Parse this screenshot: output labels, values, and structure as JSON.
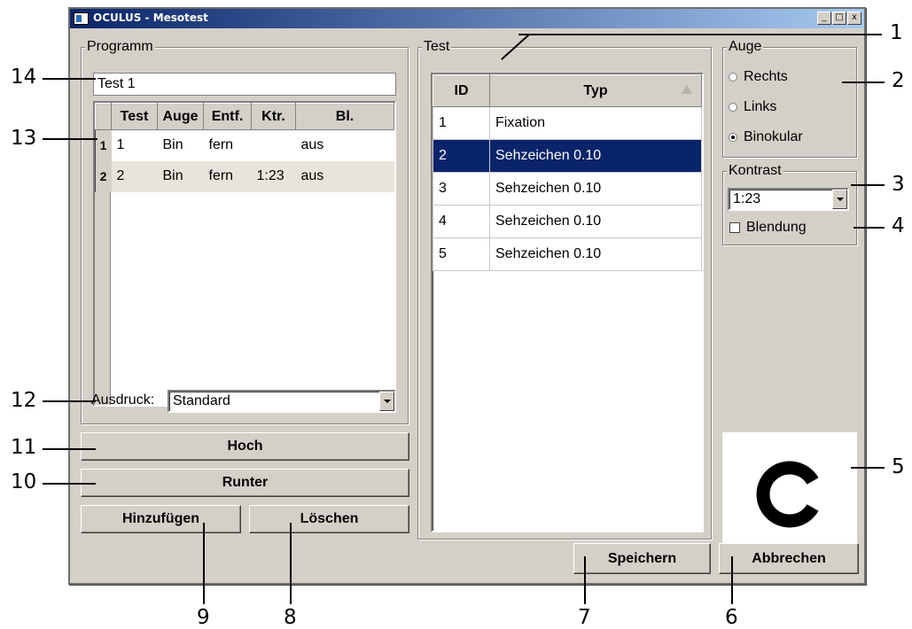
{
  "window": {
    "title": "OCULUS - Mesotest",
    "controls": [
      "_",
      "□",
      "x"
    ]
  },
  "programm": {
    "group_label": "Programm",
    "name_value": "Test 1",
    "columns": [
      "Test",
      "Auge",
      "Entf.",
      "Ktr.",
      "Bl."
    ],
    "rows": [
      {
        "rownum": "1",
        "cells": [
          "1",
          "Bin",
          "fern",
          "",
          "aus"
        ]
      },
      {
        "rownum": "2",
        "cells": [
          "2",
          "Bin",
          "fern",
          "1:23",
          "aus"
        ]
      }
    ],
    "ausdruck_label": "Ausdruck:",
    "ausdruck_value": "Standard"
  },
  "buttons": {
    "hoch": "Hoch",
    "runter": "Runter",
    "hinzufuegen": "Hinzufügen",
    "loeschen": "Löschen",
    "speichern": "Speichern",
    "abbrechen": "Abbrechen"
  },
  "test": {
    "group_label": "Test",
    "columns": [
      "ID",
      "Typ"
    ],
    "rows": [
      {
        "id": "1",
        "typ": "Fixation"
      },
      {
        "id": "2",
        "typ": "Sehzeichen  0.10"
      },
      {
        "id": "3",
        "typ": "Sehzeichen  0.10"
      },
      {
        "id": "4",
        "typ": "Sehzeichen  0.10"
      },
      {
        "id": "5",
        "typ": "Sehzeichen  0.10"
      }
    ],
    "selected_row": 2
  },
  "auge": {
    "group_label": "Auge",
    "options": [
      "Rechts",
      "Links",
      "Binokular"
    ],
    "selected": "Binokular"
  },
  "kontrast": {
    "group_label": "Kontrast",
    "value": "1:23",
    "blendung_label": "Blendung",
    "blendung_checked": false
  },
  "preview": {
    "symbol": "landolt-c-icon"
  },
  "callouts": [
    "1",
    "2",
    "3",
    "4",
    "5",
    "6",
    "7",
    "8",
    "9",
    "10",
    "11",
    "12",
    "13",
    "14"
  ]
}
